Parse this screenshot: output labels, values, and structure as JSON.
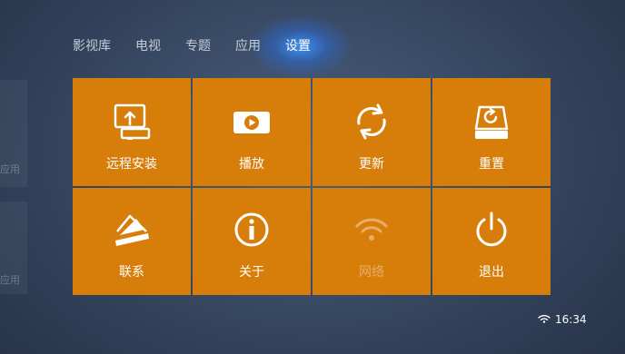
{
  "nav": {
    "tabs": [
      {
        "label": "影视库"
      },
      {
        "label": "电视"
      },
      {
        "label": "专题"
      },
      {
        "label": "应用"
      },
      {
        "label": "设置",
        "active": true
      }
    ]
  },
  "background_labels": [
    "应用",
    "应用"
  ],
  "tiles": [
    {
      "label": "远程安装",
      "icon": "remote-install-icon"
    },
    {
      "label": "播放",
      "icon": "play-icon"
    },
    {
      "label": "更新",
      "icon": "refresh-icon"
    },
    {
      "label": "重置",
      "icon": "reset-drive-icon"
    },
    {
      "label": "联系",
      "icon": "contact-envelope-icon"
    },
    {
      "label": "关于",
      "icon": "info-icon"
    },
    {
      "label": "网络",
      "icon": "wifi-icon",
      "disabled": true
    },
    {
      "label": "退出",
      "icon": "power-icon"
    }
  ],
  "status_bar": {
    "time": "16:34",
    "icon": "wifi-status-icon"
  },
  "colors": {
    "tile": "#d77d0a",
    "nav_glow": "#3c96ff",
    "background": "#33435c"
  }
}
